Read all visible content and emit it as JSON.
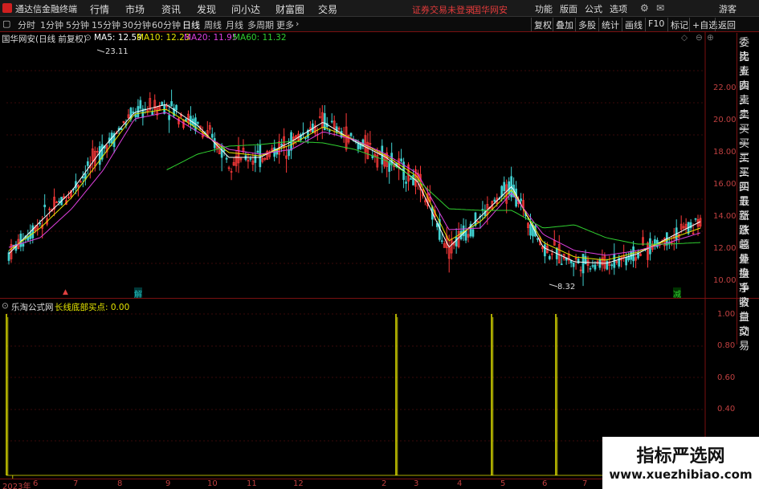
{
  "titlebar": {
    "app_name": "通达信金融终端",
    "menu": [
      "行情",
      "市场",
      "资讯",
      "发现",
      "问小达",
      "财富圈",
      "交易"
    ],
    "warning": "证券交易未登录",
    "stock": "国华网安",
    "right_menu": [
      "功能",
      "版面",
      "公式",
      "选项"
    ],
    "guest": "游客"
  },
  "toolbar": {
    "periods": [
      "分时",
      "1分钟",
      "5分钟",
      "15分钟",
      "30分钟",
      "60分钟",
      "日线",
      "周线",
      "月线",
      "多周期",
      "更多"
    ],
    "active": "日线",
    "right": [
      "复权",
      "叠加",
      "多股",
      "统计",
      "画线",
      "F10",
      "标记",
      "+自选",
      "返回"
    ]
  },
  "main": {
    "title": "国华网安(日线 前复权)",
    "ma": [
      {
        "label": "MA5: 12.59",
        "color": "#ffffff"
      },
      {
        "label": "MA10: 12.23",
        "color": "#e6e600"
      },
      {
        "label": "MA20: 11.95",
        "color": "#e040e0"
      },
      {
        "label": "MA60: 11.32",
        "color": "#30d030"
      }
    ],
    "high_label": "23.11",
    "low_label": "8.32",
    "y_ticks": [
      "22.00",
      "20.00",
      "18.00",
      "16.00",
      "14.00",
      "12.00",
      "10.00"
    ],
    "markers": [
      "解",
      "减"
    ]
  },
  "sub": {
    "title": "乐淘公式网",
    "indicator": "长线底部买点: 0.00",
    "y_ticks": [
      "1.00",
      "0.80",
      "0.60",
      "0.40"
    ]
  },
  "sidebar": [
    "委比",
    "卖五",
    "卖四",
    "卖三",
    "卖二",
    "卖一",
    "买一",
    "买二",
    "买三",
    "买四",
    "买五",
    "最新",
    "涨跌",
    "涨幅",
    "总量",
    "外盘",
    "换手",
    "净资",
    "收益",
    "自动",
    "交易"
  ],
  "dates": [
    "2023年",
    "6",
    "7",
    "8",
    "9",
    "10",
    "11",
    "12",
    "2",
    "3",
    "4",
    "5",
    "6",
    "7"
  ],
  "watermark": {
    "line1": "指标严选网",
    "line2": "www.xuezhibiao.com"
  },
  "chart_data": {
    "type": "line",
    "price_range": [
      8.0,
      23.5
    ],
    "series": [
      {
        "name": "MA5",
        "values": [
          10.6,
          12.6,
          14.5,
          17.2,
          19.4,
          19.9,
          18.6,
          16.6,
          16.6,
          17.6,
          18.8,
          17.6,
          16.6,
          15.1,
          11.0,
          12.9,
          14.8,
          11.0,
          10.1,
          10.0,
          10.6,
          11.6,
          12.6
        ]
      },
      {
        "name": "MA10",
        "values": [
          10.8,
          12.2,
          14.1,
          16.7,
          19.3,
          19.6,
          18.4,
          16.9,
          16.7,
          17.4,
          18.5,
          17.7,
          16.7,
          15.4,
          11.4,
          12.6,
          14.6,
          11.3,
          10.4,
          10.2,
          10.7,
          11.5,
          12.2
        ]
      },
      {
        "name": "MA20",
        "values": [
          11.0,
          11.6,
          13.4,
          15.8,
          19.0,
          19.4,
          18.2,
          17.1,
          16.8,
          17.1,
          18.2,
          17.7,
          16.8,
          15.6,
          12.1,
          12.2,
          14.4,
          11.8,
          10.8,
          10.5,
          10.8,
          11.3,
          11.9
        ]
      },
      {
        "name": "MA60",
        "values": [
          null,
          null,
          null,
          null,
          null,
          15.8,
          16.8,
          17.3,
          17.4,
          17.6,
          17.5,
          17.1,
          16.4,
          15.2,
          13.4,
          13.3,
          13.3,
          12.2,
          12.4,
          11.6,
          11.2,
          11.2,
          11.3
        ]
      }
    ],
    "signals": [
      0,
      1,
      1,
      1,
      1
    ]
  }
}
